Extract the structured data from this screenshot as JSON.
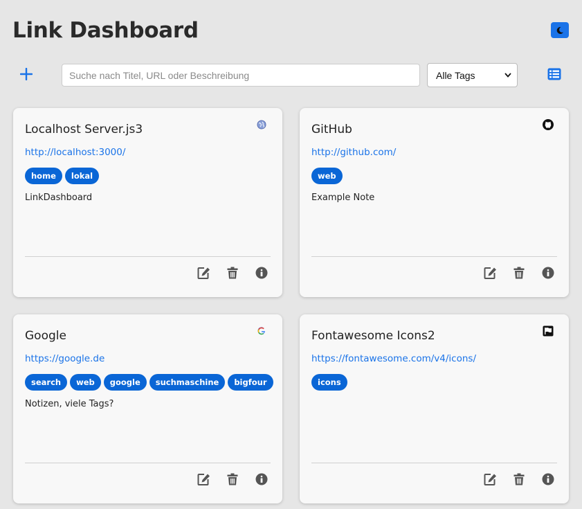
{
  "header": {
    "title": "Link Dashboard"
  },
  "toolbar": {
    "search_placeholder": "Suche nach Titel, URL oder Beschreibung",
    "search_value": "",
    "tag_filter": "Alle Tags"
  },
  "colors": {
    "accent": "#1a73e8",
    "tag_bg": "#0a66d6",
    "background": "#e6e6e6",
    "card_bg": "#f8f8f8"
  },
  "cards": [
    {
      "title": "Localhost Server.js3",
      "url": "http://localhost:3000/",
      "favicon": "globe-icon",
      "tags": [
        "home",
        "lokal"
      ],
      "note": "LinkDashboard"
    },
    {
      "title": "GitHub",
      "url": "http://github.com/",
      "favicon": "github-icon",
      "tags": [
        "web"
      ],
      "note": "Example Note"
    },
    {
      "title": "Google",
      "url": "https://google.de",
      "favicon": "google-icon",
      "tags": [
        "search",
        "web",
        "google",
        "suchmaschine",
        "bigfour"
      ],
      "note": "Notizen, viele Tags?"
    },
    {
      "title": "Fontawesome Icons2",
      "url": "https://fontawesome.com/v4/icons/",
      "favicon": "flag-icon",
      "tags": [
        "icons"
      ],
      "note": ""
    }
  ]
}
